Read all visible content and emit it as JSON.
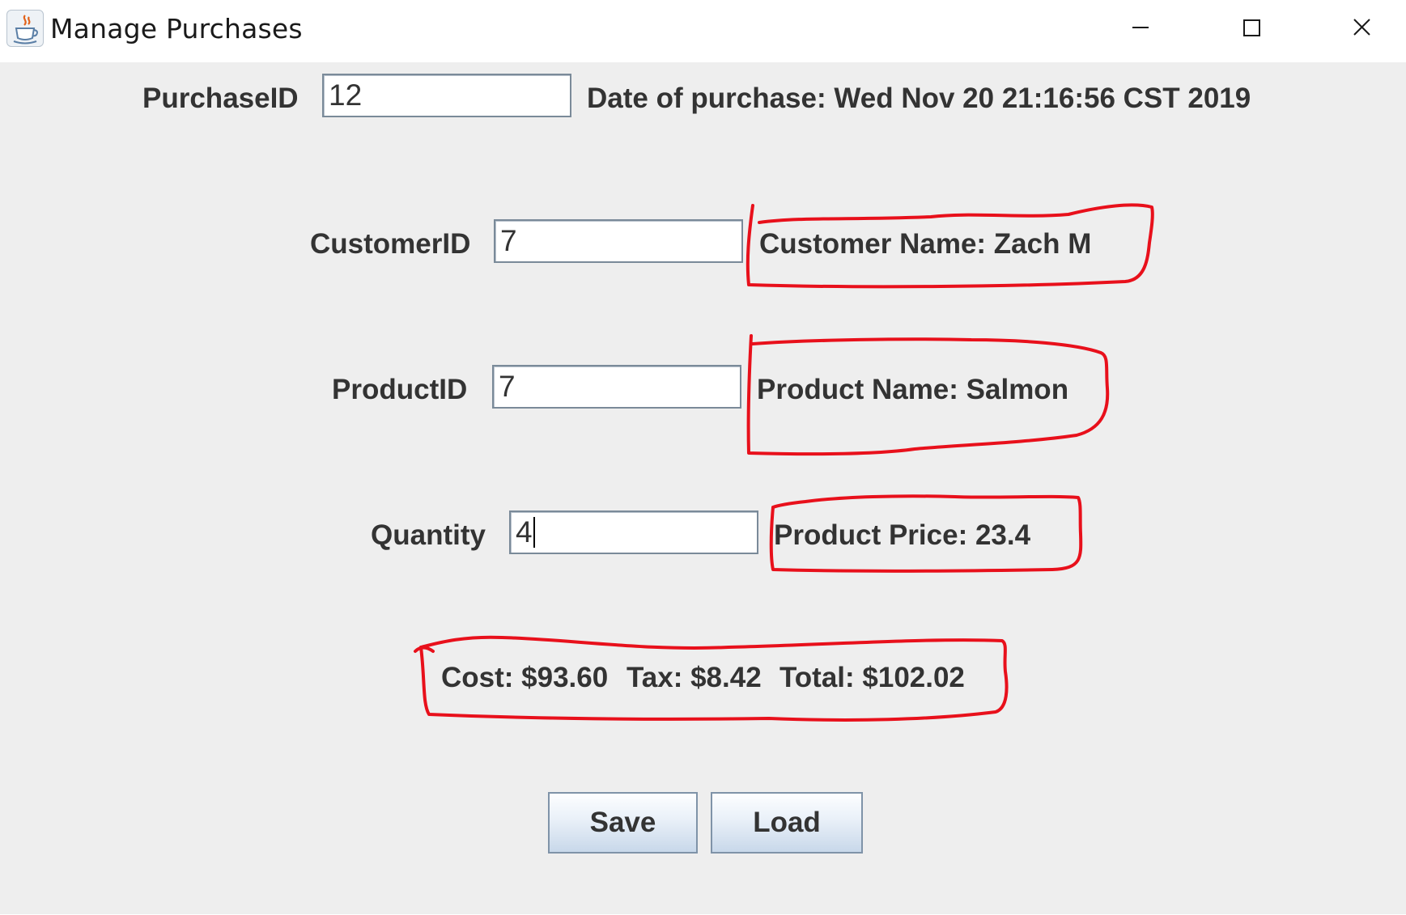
{
  "window": {
    "title": "Manage Purchases",
    "app_icon": "java-cup-icon",
    "controls": [
      "minimize-icon",
      "maximize-icon",
      "close-icon"
    ]
  },
  "form": {
    "purchase_id": {
      "label": "PurchaseID",
      "value": "12"
    },
    "date_of_purchase": "Date of purchase: Wed Nov 20 21:16:56 CST 2019",
    "customer_id": {
      "label": "CustomerID",
      "value": "7"
    },
    "customer_name": "Customer Name: Zach M",
    "product_id": {
      "label": "ProductID",
      "value": "7"
    },
    "product_name": "Product Name: Salmon",
    "quantity": {
      "label": "Quantity",
      "value": "4"
    },
    "product_price": "Product Price: 23.4",
    "summary": {
      "cost": "Cost: $93.60",
      "tax": "Tax: $8.42",
      "total": "Total: $102.02"
    }
  },
  "buttons": {
    "save": "Save",
    "load": "Load"
  },
  "colors": {
    "panel_background": "#eeeeee",
    "label_text": "#333333",
    "annotation_red": "#e8101b"
  }
}
